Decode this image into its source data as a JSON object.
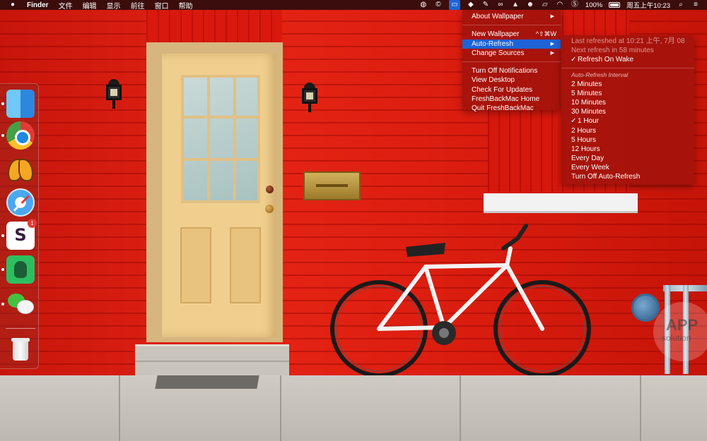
{
  "menubar": {
    "app_name": "Finder",
    "menus": [
      "文件",
      "编辑",
      "显示",
      "前往",
      "窗口",
      "帮助"
    ],
    "battery_percent": "100%",
    "clock": "周五上午10:23",
    "status_icons": [
      "wechat-icon",
      "circle-c-icon",
      "display-icon",
      "dropbox-icon",
      "feather-icon",
      "link-icon",
      "tent-icon",
      "bear-icon",
      "airplay-icon",
      "wifi-icon",
      "s-app-icon",
      "battery-icon",
      "search-icon",
      "list-icon"
    ]
  },
  "menu": {
    "items": [
      {
        "label": "About Wallpaper",
        "submenu": true
      },
      {
        "label": "New Wallpaper",
        "shortcut": "^⇧⌘W"
      },
      {
        "label": "Auto-Refresh",
        "submenu": true,
        "highlighted": true
      },
      {
        "label": "Change Sources",
        "submenu": true
      },
      {
        "label": "Turn Off Notifications"
      },
      {
        "label": "View Desktop"
      },
      {
        "label": "Check For Updates"
      },
      {
        "label": "FreshBackMac Home"
      },
      {
        "label": "Quit FreshBackMac"
      }
    ],
    "highlight_color": "#1d63d6"
  },
  "submenu": {
    "last_refreshed": "Last refreshed at 10:21 上午, 7月 08",
    "next_refresh": "Next refresh in 58 minutes",
    "refresh_on_wake": "Refresh On Wake",
    "interval_header": "Auto-Refresh Interval",
    "intervals": [
      {
        "label": "2 Minutes"
      },
      {
        "label": "5 Minutes"
      },
      {
        "label": "10 Minutes"
      },
      {
        "label": "30 Minutes"
      },
      {
        "label": "1 Hour",
        "checked": true
      },
      {
        "label": "2 Hours"
      },
      {
        "label": "5 Hours"
      },
      {
        "label": "12 Hours"
      },
      {
        "label": "Every Day"
      },
      {
        "label": "Every Week"
      },
      {
        "label": "Turn Off Auto-Refresh"
      }
    ],
    "check_mark": "✓"
  },
  "dock": {
    "apps": [
      "Finder",
      "Chrome",
      "Tes",
      "Safari",
      "Slack",
      "Evernote",
      "WeChat",
      "Trash"
    ],
    "slack_badge": "1"
  },
  "watermark": {
    "line1": "APP",
    "line2": "solution"
  }
}
